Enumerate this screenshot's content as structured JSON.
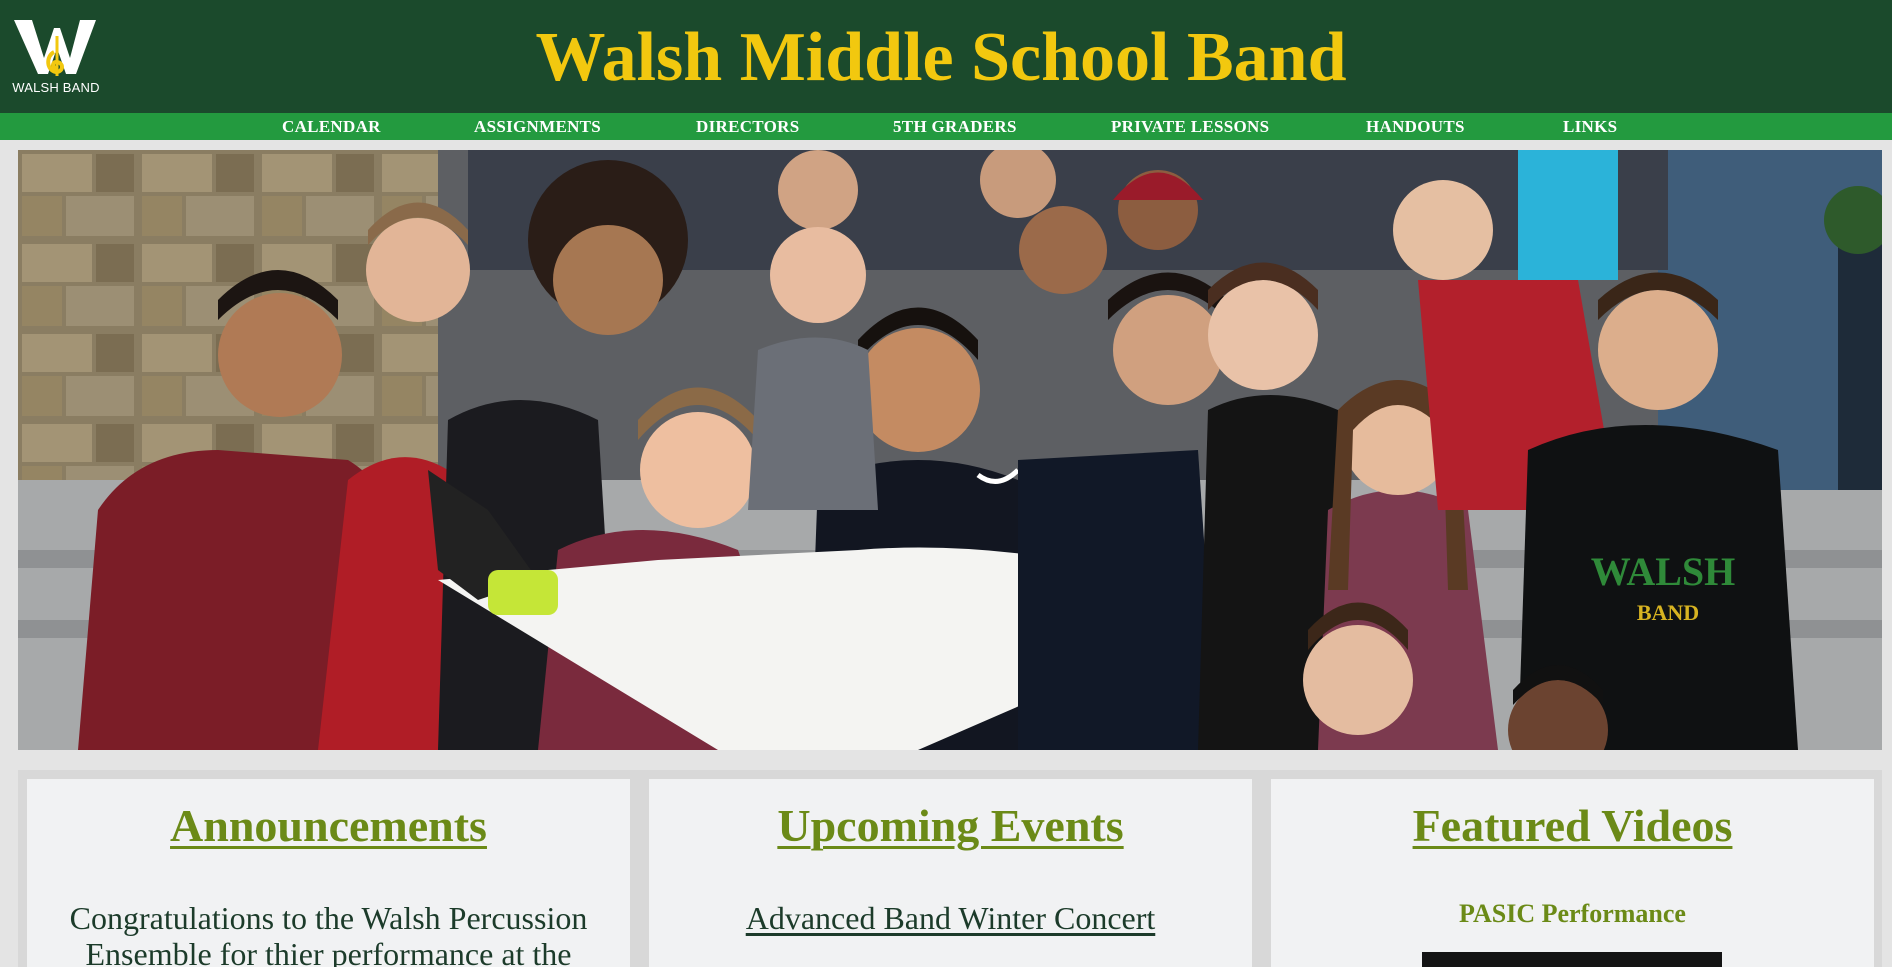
{
  "header": {
    "logo_text": "WALSH BAND",
    "title": "Walsh Middle School Band"
  },
  "nav": {
    "items": [
      {
        "label": "CALENDAR"
      },
      {
        "label": "ASSIGNMENTS"
      },
      {
        "label": "DIRECTORS"
      },
      {
        "label": "5TH GRADERS"
      },
      {
        "label": "PRIVATE LESSONS"
      },
      {
        "label": "HANDOUTS"
      },
      {
        "label": "LINKS"
      }
    ]
  },
  "hero": {
    "shirt_text": "WALSH",
    "shirt_subtext": "BAND"
  },
  "cards": {
    "announcements": {
      "title": "Announcements",
      "body": "Congratulations to the Walsh Percussion Ensemble for thier performance at the"
    },
    "events": {
      "title": "Upcoming Events",
      "first_event": "Advanced Band Winter Concert"
    },
    "videos": {
      "title": "Featured Videos",
      "first_video": "PASIC Performance"
    }
  },
  "colors": {
    "header_bg": "#1b4a2c",
    "nav_bg": "#239a3f",
    "title_gold": "#f2c80f",
    "card_heading_green": "#6b8a17"
  },
  "icons": {
    "logo": "walsh-band-logo-icon",
    "video": "video-thumbnail"
  }
}
